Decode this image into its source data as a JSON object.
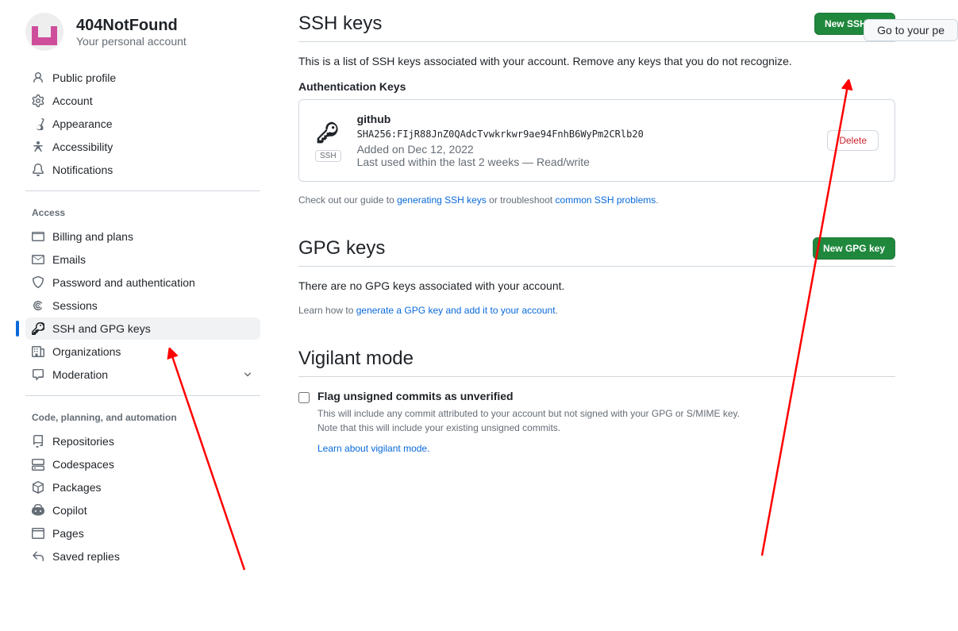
{
  "profile": {
    "username": "404NotFound",
    "subtitle": "Your personal account"
  },
  "top_button": "Go to your pe",
  "sidebar": {
    "groups": [
      {
        "heading": null,
        "items": [
          {
            "icon": "person",
            "label": "Public profile"
          },
          {
            "icon": "gear",
            "label": "Account"
          },
          {
            "icon": "brush",
            "label": "Appearance"
          },
          {
            "icon": "accessibility",
            "label": "Accessibility"
          },
          {
            "icon": "bell",
            "label": "Notifications"
          }
        ]
      },
      {
        "heading": "Access",
        "items": [
          {
            "icon": "credit-card",
            "label": "Billing and plans"
          },
          {
            "icon": "mail",
            "label": "Emails"
          },
          {
            "icon": "shield",
            "label": "Password and authentication"
          },
          {
            "icon": "broadcast",
            "label": "Sessions"
          },
          {
            "icon": "key",
            "label": "SSH and GPG keys",
            "active": true
          },
          {
            "icon": "org",
            "label": "Organizations"
          },
          {
            "icon": "comment",
            "label": "Moderation",
            "chevron": true
          }
        ]
      },
      {
        "heading": "Code, planning, and automation",
        "items": [
          {
            "icon": "repo",
            "label": "Repositories"
          },
          {
            "icon": "codespaces",
            "label": "Codespaces"
          },
          {
            "icon": "package",
            "label": "Packages"
          },
          {
            "icon": "copilot",
            "label": "Copilot"
          },
          {
            "icon": "browser",
            "label": "Pages"
          },
          {
            "icon": "reply",
            "label": "Saved replies"
          }
        ]
      }
    ]
  },
  "ssh": {
    "title": "SSH keys",
    "new_button": "New SSH key",
    "description": "This is a list of SSH keys associated with your account. Remove any keys that you do not recognize.",
    "auth_heading": "Authentication Keys",
    "key": {
      "name": "github",
      "hash": "SHA256:FIjR88JnZ0QAdcTvwkrkwr9ae94FnhB6WyPm2CRlb20",
      "added": "Added on Dec 12, 2022",
      "used": "Last used within the last 2 weeks — Read/write",
      "badge": "SSH",
      "delete": "Delete"
    },
    "guide_prefix": "Check out our guide to ",
    "guide_link": "generating SSH keys",
    "guide_mid": " or troubleshoot ",
    "guide_link2": "common SSH problems",
    "guide_suffix": "."
  },
  "gpg": {
    "title": "GPG keys",
    "new_button": "New GPG key",
    "description": "There are no GPG keys associated with your account.",
    "learn_prefix": "Learn how to ",
    "learn_link": "generate a GPG key and add it to your account",
    "learn_suffix": "."
  },
  "vigilant": {
    "title": "Vigilant mode",
    "checkbox_label": "Flag unsigned commits as unverified",
    "desc1": "This will include any commit attributed to your account but not signed with your GPG or S/MIME key.",
    "desc2": "Note that this will include your existing unsigned commits.",
    "learn_link": "Learn about vigilant mode."
  }
}
